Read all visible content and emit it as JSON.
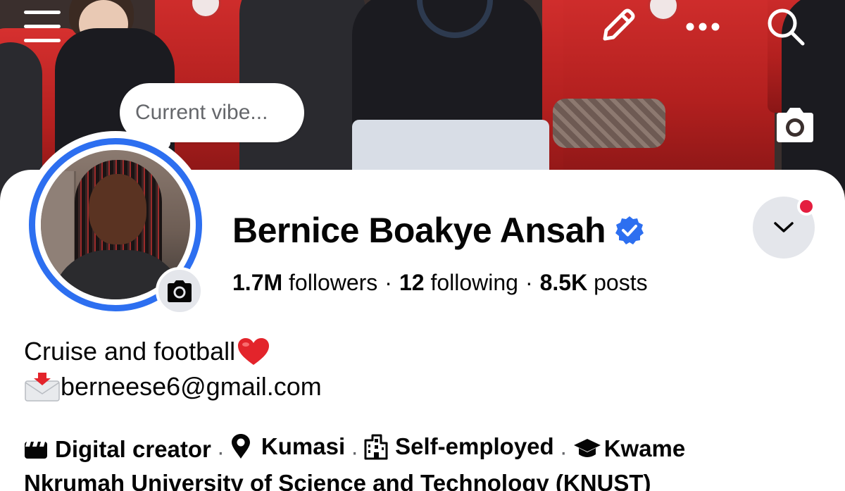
{
  "header": {
    "menu_icon": "hamburger-menu-icon",
    "edit_icon": "pencil-icon",
    "more_icon": "ellipsis-icon",
    "search_icon": "search-icon",
    "cover_camera_icon": "camera-icon"
  },
  "note_bubble": {
    "placeholder": "Current vibe..."
  },
  "profile": {
    "name": "Bernice Boakye Ansah",
    "verified": true,
    "verified_color": "#2d6ff0",
    "avatar_ring_color": "#2d6ff0",
    "avatar_camera_icon": "camera-icon",
    "notification_dot_color": "#e41e3f"
  },
  "stats": {
    "followers_count": "1.7M",
    "followers_label": "followers",
    "following_count": "12",
    "following_label": "following",
    "posts_count": "8.5K",
    "posts_label": "posts",
    "separator": "·"
  },
  "bio": {
    "line1_text": "Cruise and football",
    "line1_emoji": "red-heart-icon",
    "line2_emoji": "envelope-with-arrow-icon",
    "line2_text": "berneese6@gmail.com"
  },
  "details": {
    "category": "Digital creator",
    "category_icon": "film-clapper-icon",
    "location": "Kumasi",
    "location_icon": "map-pin-icon",
    "work": "Self-employed",
    "work_icon": "building-icon",
    "education_part1": "Kwame",
    "education_part2": "Nkrumah University of Science and Technology (KNUST)",
    "education_icon": "graduation-cap-icon",
    "separator": "·"
  }
}
